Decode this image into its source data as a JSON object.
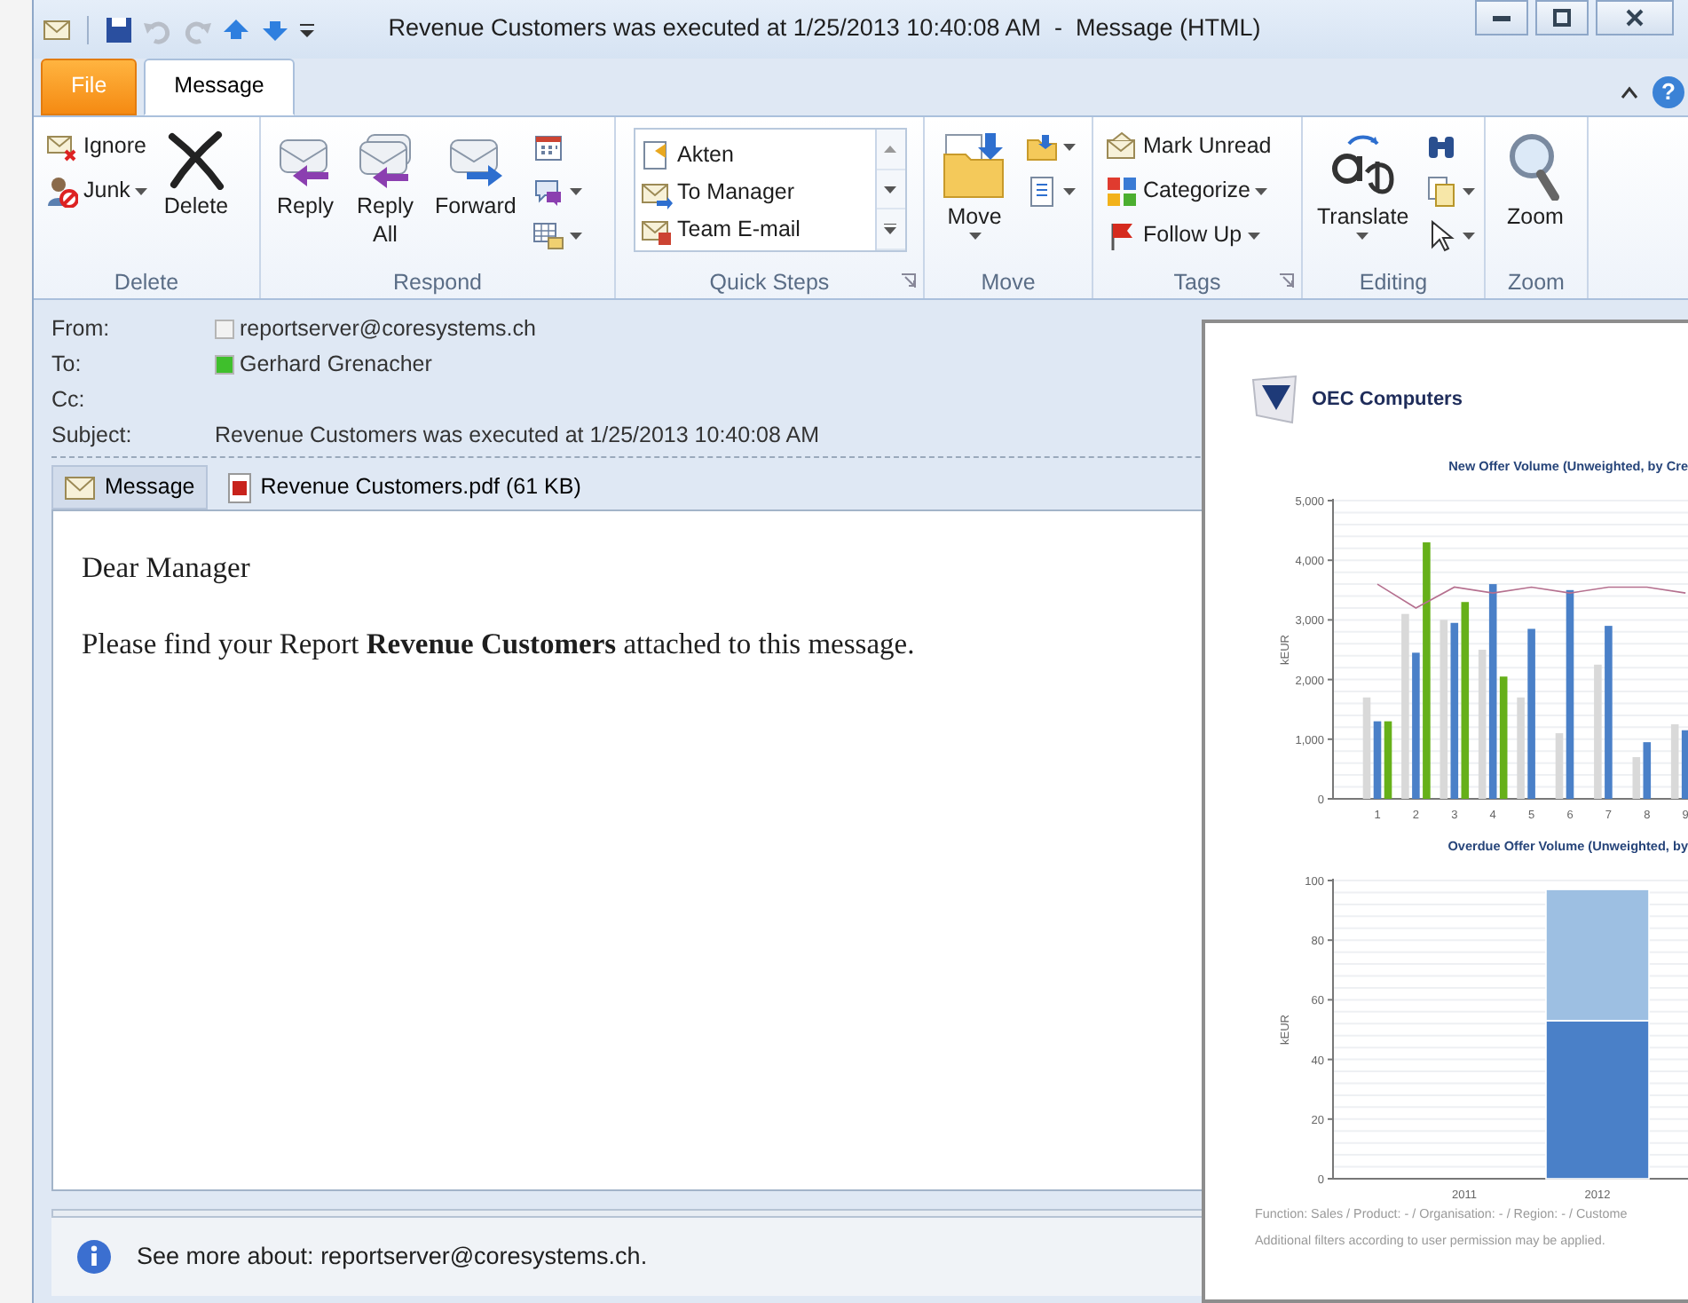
{
  "window": {
    "title": "Revenue Customers was executed at 1/25/2013 10:40:08 AM  -  Message (HTML)",
    "quick_access": [
      {
        "kind": "save",
        "disabled": false
      },
      {
        "kind": "undo",
        "disabled": true
      },
      {
        "kind": "redo",
        "disabled": true
      },
      {
        "kind": "up",
        "disabled": false
      },
      {
        "kind": "down",
        "disabled": false
      },
      {
        "kind": "customize",
        "disabled": false
      }
    ]
  },
  "ribbon_tabs": [
    {
      "label": "File",
      "kind": "file",
      "selected": false
    },
    {
      "label": "Message",
      "kind": "tab",
      "selected": true
    }
  ],
  "help": "?",
  "ribbon_groups": [
    {
      "label": "Delete",
      "launcher": false,
      "columns": [
        {
          "kind": "stack",
          "items": [
            {
              "label": "Ignore",
              "dropdown": false
            },
            {
              "label": "Junk",
              "dropdown": true
            }
          ]
        },
        {
          "kind": "large",
          "items": [
            {
              "label": "Delete",
              "dropdown": false
            }
          ]
        }
      ]
    },
    {
      "label": "Respond",
      "launcher": false,
      "columns": [
        {
          "kind": "large",
          "items": [
            {
              "label": "Reply",
              "dropdown": false
            }
          ]
        },
        {
          "kind": "large",
          "items": [
            {
              "label": "Reply All",
              "dropdown": false
            }
          ]
        },
        {
          "kind": "large",
          "items": [
            {
              "label": "Forward",
              "dropdown": false
            }
          ]
        },
        {
          "kind": "stack",
          "items": [
            {
              "dropdown": false
            },
            {
              "dropdown": true
            },
            {
              "dropdown": true
            }
          ]
        }
      ]
    },
    {
      "label": "Quick Steps",
      "launcher": true,
      "columns": [
        {
          "kind": "gallery",
          "items": [
            {
              "label": "Akten"
            },
            {
              "label": "To Manager"
            },
            {
              "label": "Team E-mail"
            }
          ]
        }
      ]
    },
    {
      "label": "Move",
      "launcher": false,
      "columns": [
        {
          "kind": "large",
          "items": [
            {
              "label": "Move",
              "dropdown": true
            }
          ]
        },
        {
          "kind": "stack",
          "items": [
            {
              "dropdown": true
            },
            {
              "dropdown": true
            }
          ]
        }
      ]
    },
    {
      "label": "Tags",
      "launcher": true,
      "columns": [
        {
          "kind": "stack",
          "items": [
            {
              "label": "Mark Unread",
              "dropdown": false
            },
            {
              "label": "Categorize",
              "dropdown": true
            },
            {
              "label": "Follow Up",
              "dropdown": true
            }
          ]
        }
      ]
    },
    {
      "label": "Editing",
      "launcher": false,
      "columns": [
        {
          "kind": "large",
          "items": [
            {
              "label": "Translate",
              "dropdown": true
            }
          ]
        },
        {
          "kind": "stack",
          "items": [
            {
              "dropdown": false
            },
            {
              "dropdown": true
            },
            {
              "dropdown": true
            }
          ]
        }
      ]
    },
    {
      "label": "Zoom",
      "launcher": false,
      "columns": [
        {
          "kind": "large",
          "items": [
            {
              "label": "Zoom",
              "dropdown": false
            }
          ]
        }
      ]
    }
  ],
  "header": [
    {
      "label": "From:",
      "value": "reportserver@coresystems.ch",
      "color": "#f2f2f2"
    },
    {
      "label": "To:",
      "value": "Gerhard Grenacher",
      "color": "#3fbf2c"
    },
    {
      "label": "Cc:"
    },
    {
      "label": "Subject:",
      "value": "Revenue Customers was executed at 1/25/2013 10:40:08 AM"
    }
  ],
  "attachments": [
    {
      "label": "Message",
      "kind": "message",
      "selected": true
    },
    {
      "label": "Revenue Customers.pdf (61 KB)",
      "kind": "pdf",
      "selected": false
    }
  ],
  "body": [
    "Dear Manager",
    "Please find your Report **Revenue Customers** attached to this message."
  ],
  "info_bar": {
    "text": "See more about: reportserver@coresystems.ch."
  },
  "preview": {
    "logo": "OEC Computers",
    "charts": [
      {
        "chart_data": {
          "type": "bar",
          "title": "New Offer Volume (Unweighted, by Cre",
          "ylabel": "kEUR",
          "categories": [
            "1",
            "2",
            "3",
            "4",
            "5",
            "6",
            "7",
            "8",
            "9"
          ],
          "series": [
            {
              "color": "#d9d9d9",
              "values": [
                1700,
                3100,
                3000,
                2500,
                1700,
                1100,
                2250,
                700,
                1250
              ]
            },
            {
              "color": "#4a80c8",
              "values": [
                1300,
                2450,
                2950,
                3600,
                2850,
                3500,
                2900,
                950,
                1150
              ]
            },
            {
              "color": "#66b019",
              "values": [
                1300,
                4300,
                3300,
                2050,
                null,
                null,
                null,
                null,
                null
              ]
            },
            {
              "color": "#b5708f",
              "type": "line",
              "values": [
                3600,
                3200,
                3550,
                3450,
                3550,
                3450,
                3550,
                3550,
                3450
              ]
            }
          ],
          "grid": true,
          "ylim": [
            0,
            5000
          ],
          "yticks": [
            {
              "value": 0,
              "label": "0"
            },
            {
              "value": 1000,
              "label": "1,000"
            },
            {
              "value": 2000,
              "label": "2,000"
            },
            {
              "value": 3000,
              "label": "3,000"
            },
            {
              "value": 4000,
              "label": "4,000"
            },
            {
              "value": 5000,
              "label": "5,000"
            }
          ]
        }
      },
      {
        "chart_data": {
          "type": "bar",
          "stacked": true,
          "title": "Overdue Offer Volume (Unweighted, by",
          "ylabel": "kEUR",
          "categories": [
            "2011",
            "2012"
          ],
          "series": [
            {
              "color": "#4a80c8",
              "values": [
                null,
                53
              ]
            },
            {
              "color": "#9dbfe2",
              "values": [
                null,
                44
              ]
            }
          ],
          "grid": true,
          "ylim": [
            0,
            100
          ],
          "yticks": [
            0,
            20,
            40,
            60,
            80,
            100
          ]
        }
      }
    ],
    "footer": [
      "Function: Sales / Product: - / Organisation: - / Region: - / Custome",
      "Additional filters according to user permission may be applied."
    ]
  }
}
